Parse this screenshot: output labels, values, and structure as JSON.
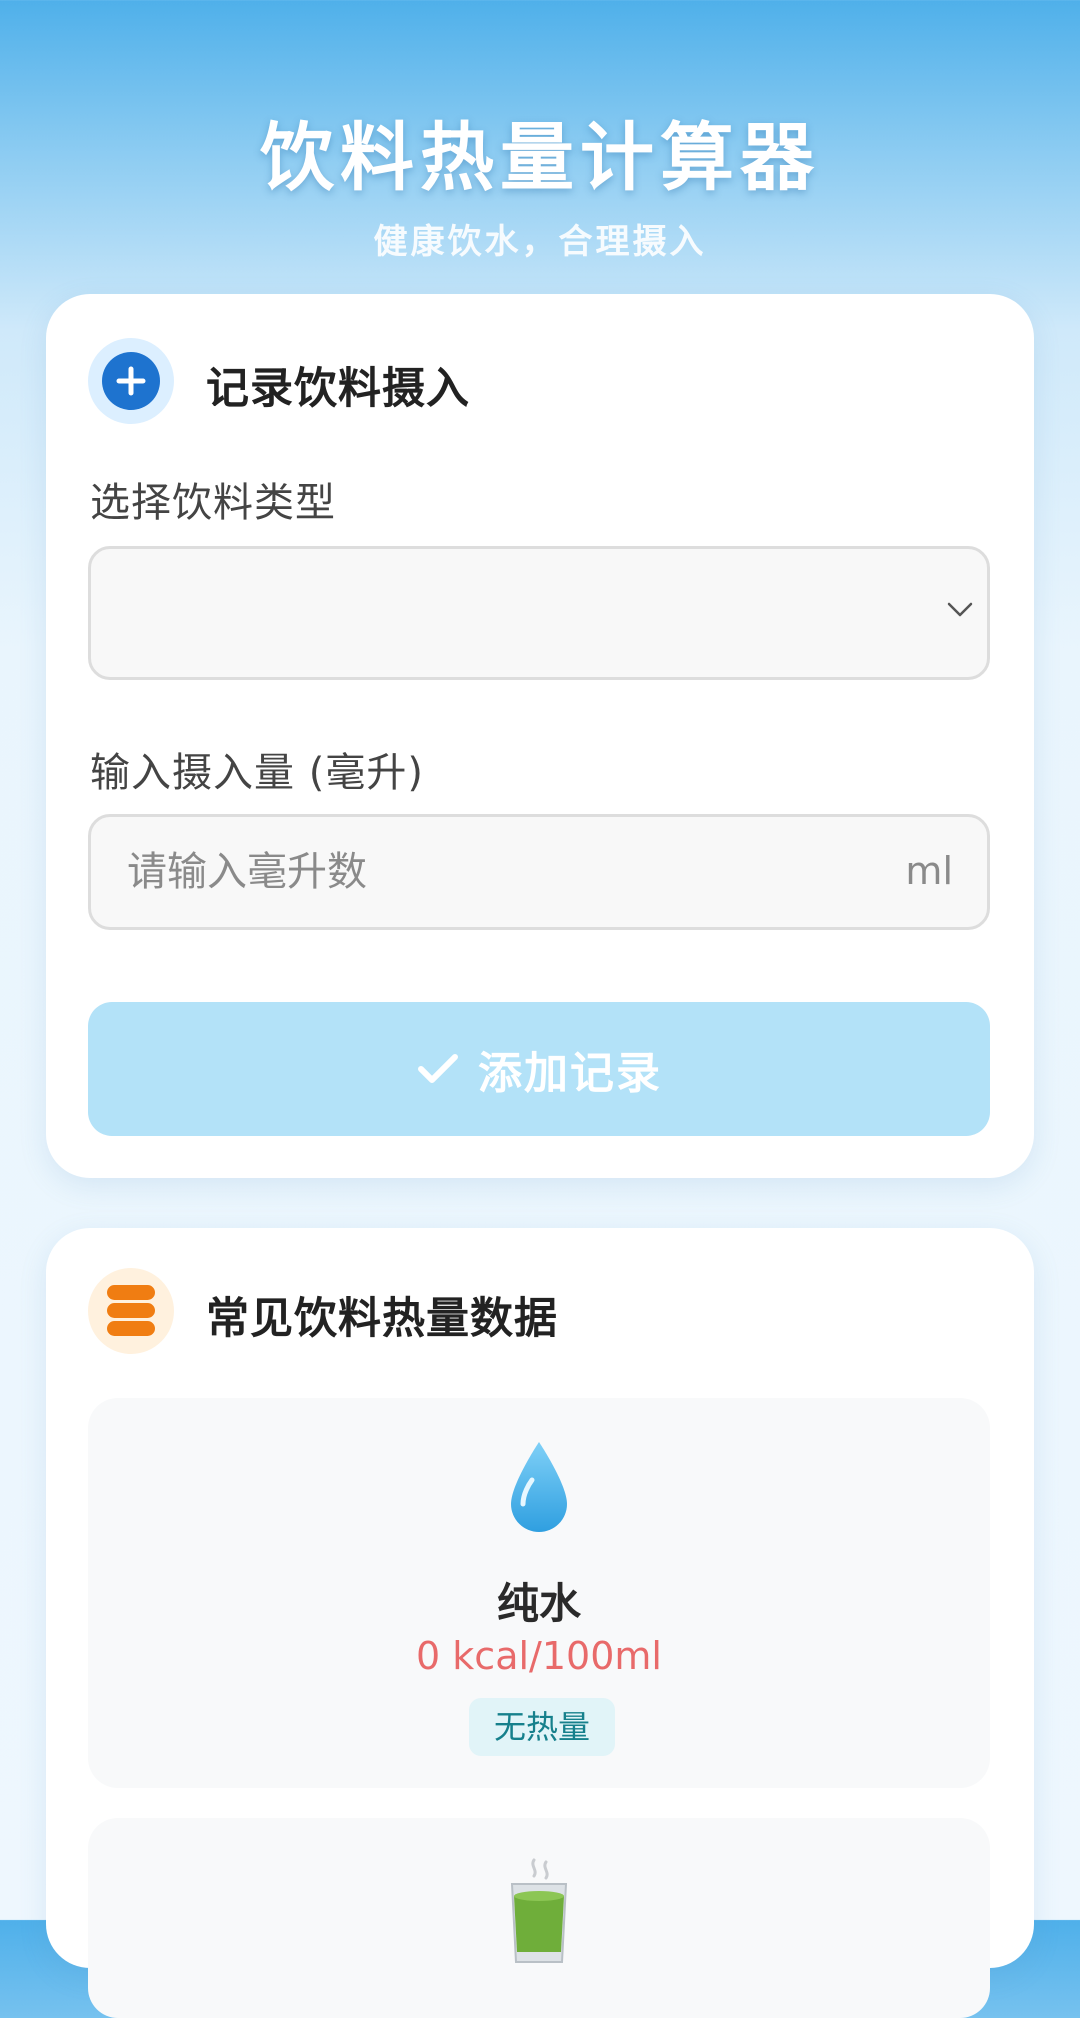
{
  "header": {
    "title": "饮料热量计算器",
    "subtitle": "健康饮水，合理摄入"
  },
  "record_card": {
    "title": "记录饮料摄入",
    "icon": "plus-circle-icon",
    "type_label": "选择饮料类型",
    "type_value": "",
    "amount_label": "输入摄入量 (毫升)",
    "amount_placeholder": "请输入毫升数",
    "amount_unit": "ml",
    "add_button_label": "添加记录"
  },
  "data_card": {
    "title": "常见饮料热量数据",
    "icon": "database-icon",
    "drinks": [
      {
        "icon": "water-drop-icon",
        "name": "纯水",
        "kcal": "0 kcal/100ml",
        "tag": "无热量"
      },
      {
        "icon": "tea-cup-icon"
      }
    ]
  },
  "colors": {
    "header_blue": "#4fb0ea",
    "primary_blue": "#1e73cf",
    "button_disabled": "#b3e2f8",
    "kcal_red": "#e86a6a",
    "tag_teal": "#16808c",
    "db_orange": "#f07d12"
  }
}
